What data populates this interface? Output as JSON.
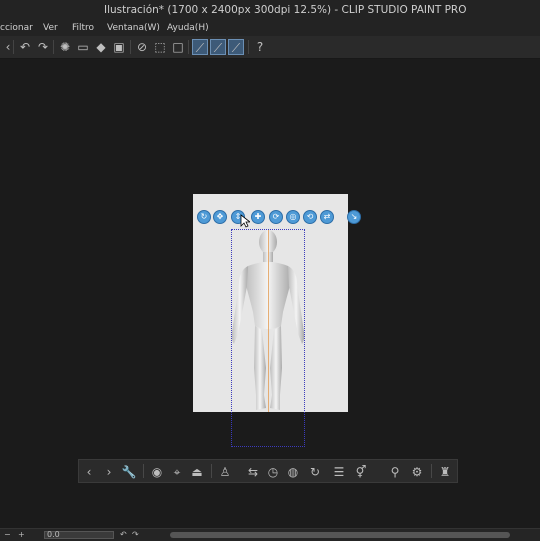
{
  "window": {
    "title": "Ilustración* (1700 x 2400px 300dpi 12.5%) - CLIP STUDIO PAINT PRO"
  },
  "menu": [
    "ccionar",
    "Ver",
    "Filtro",
    "Ventana(W)",
    "Ayuda(H)"
  ],
  "toolbar_icons": [
    "back-icon",
    "undo-icon",
    "redo-icon",
    "loading-icon",
    "clear-icon",
    "fill-icon",
    "bucket-icon",
    "stamp-icon",
    "select-all-icon",
    "deselect-icon",
    "invert-icon",
    "ruler-snap-icon",
    "special-ruler-icon",
    "grid-snap-icon",
    "help-icon"
  ],
  "object_launcher_icons": [
    "previous-icon",
    "next-icon",
    "settings-icon",
    "camera-icon",
    "fit-icon",
    "floor-icon",
    "pose-icon",
    "flip-icon",
    "lock-icon",
    "register-icon",
    "scale-icon",
    "body-shape-icon",
    "gender-icon",
    "image-icon",
    "add-icon"
  ],
  "float_bar_icons": [
    "camera-rotate-icon",
    "camera-pan-icon",
    "camera-move-icon",
    "object-pan-icon",
    "object-rotate-icon",
    "object-rotate-xy-icon",
    "object-rotate-z-icon",
    "object-move-icon",
    "object-scale-icon"
  ],
  "statusbar": {
    "zoom_value": "0.0"
  },
  "colors": {
    "float_icon": "#4e9ad6",
    "bbox": "#3b3bbd",
    "center_line": "#e4a15d"
  }
}
